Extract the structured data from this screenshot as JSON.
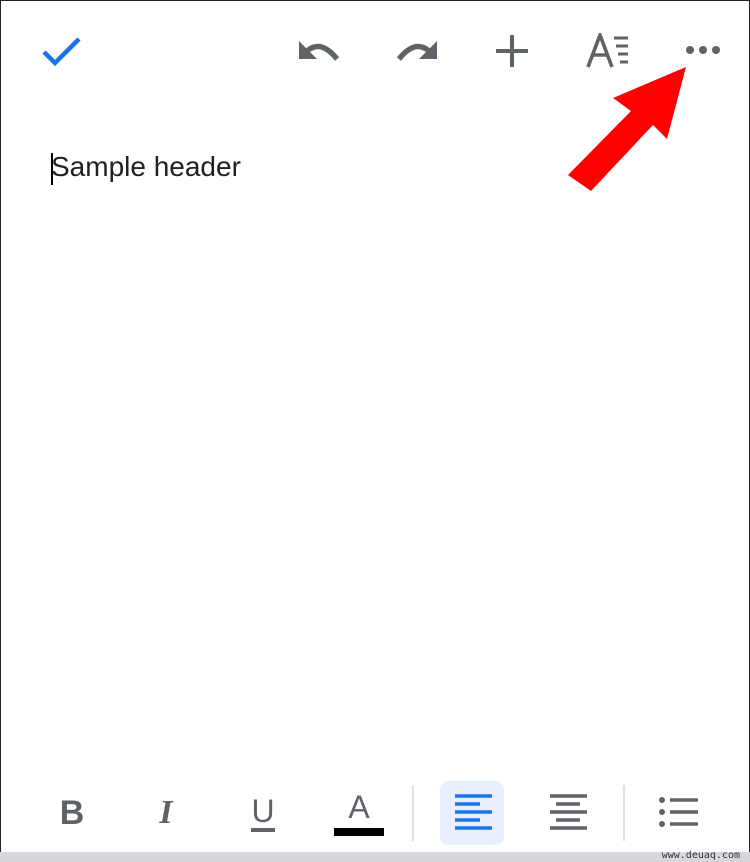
{
  "toolbar": {
    "icons": [
      "check-icon",
      "undo-icon",
      "redo-icon",
      "insert-plus-icon",
      "text-format-icon",
      "more-options-icon"
    ],
    "icon_color": "#5f6368",
    "accent": "#1a73e8"
  },
  "document": {
    "text": "Sample header"
  },
  "format_bar": {
    "bold": "B",
    "italic": "I",
    "underline": "U",
    "text_color": "A",
    "text_color_value": "#000000",
    "active_alignment": "left"
  },
  "annotation": {
    "arrow_color": "#ff0000"
  },
  "watermark": "www.deuaq.com"
}
